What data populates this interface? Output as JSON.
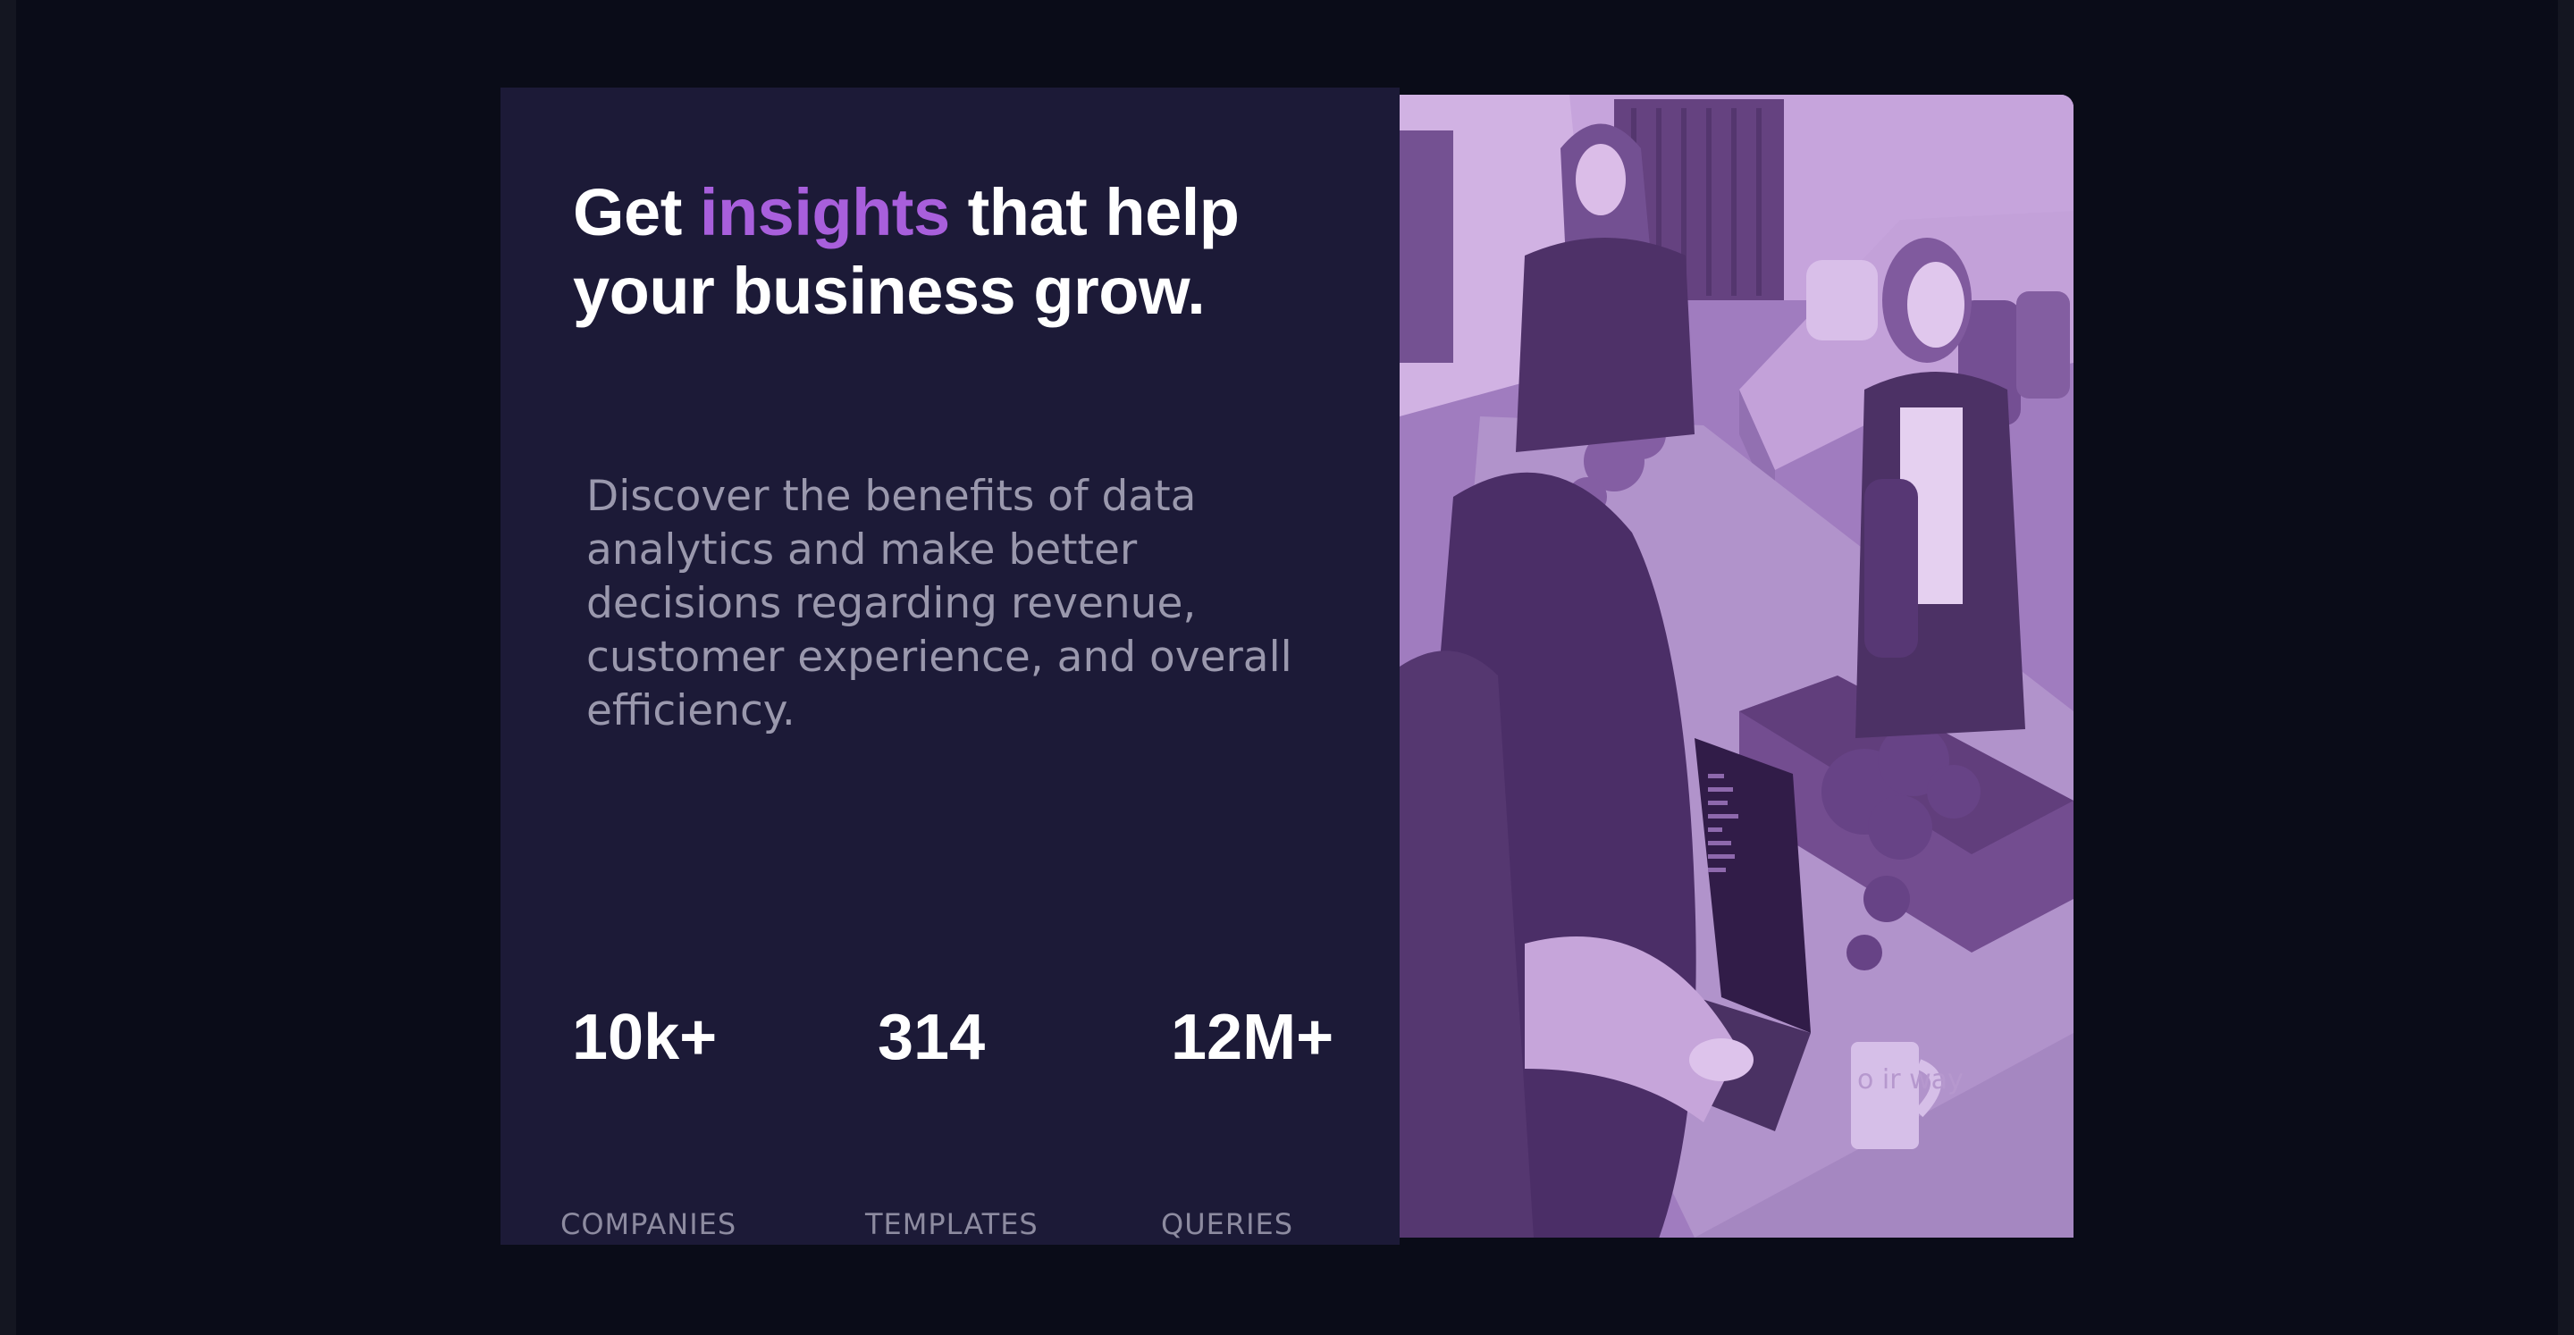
{
  "hero": {
    "title_prefix": "Get ",
    "title_accent": "insights",
    "title_suffix": " that help your business grow.",
    "description": "Discover the benefits of data analytics and make better decisions regarding revenue, customer experience, and overall efficiency.",
    "accent_color": "#a85fdc",
    "background_color": "#1c1a37"
  },
  "stats": [
    {
      "value": "10k+",
      "label": "COMPANIES"
    },
    {
      "value": "314",
      "label": "TEMPLATES"
    },
    {
      "value": "12M+",
      "label": "QUERIES"
    }
  ],
  "image": {
    "overlay_color": "#aa5cdb",
    "mug_text": "o ir way"
  }
}
